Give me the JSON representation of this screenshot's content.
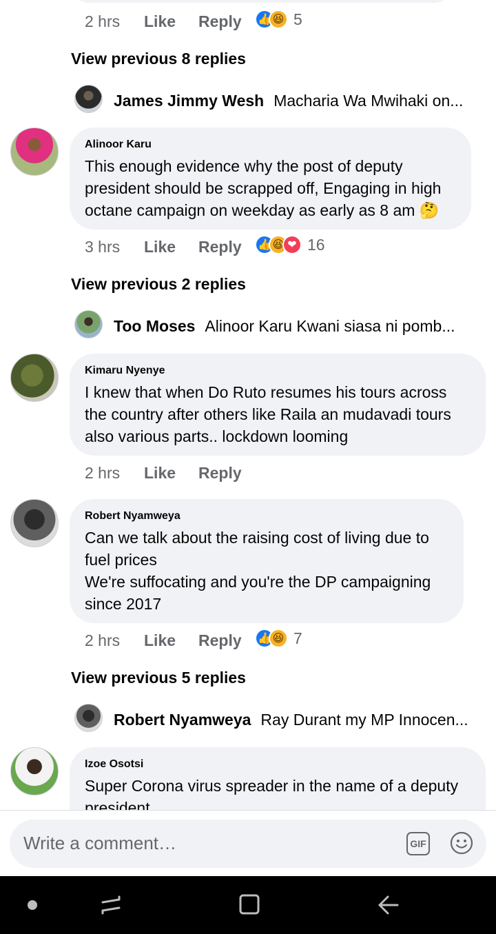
{
  "comments_top": {
    "meta": {
      "time": "2 hrs",
      "like": "Like",
      "reply": "Reply",
      "count": "5"
    },
    "view_prev": "View previous 8 replies",
    "reply": {
      "name": "James Jimmy Wesh",
      "text": "Macharia Wa Mwihaki on..."
    }
  },
  "comment1": {
    "author": "Alinoor Karu",
    "text": "This enough evidence why the post of deputy president should be scrapped off, Engaging in high octane campaign on weekday as early as 8 am 🤔",
    "meta": {
      "time": "3 hrs",
      "like": "Like",
      "reply": "Reply",
      "count": "16"
    },
    "view_prev": "View previous 2 replies",
    "reply": {
      "name": "Too Moses",
      "text": "Alinoor Karu Kwani siasa ni pomb..."
    }
  },
  "comment2": {
    "author": "Kimaru Nyenye",
    "text": "I knew that when Do Ruto resumes his tours across the country after others like Raila an mudavadi tours also various parts.. lockdown looming",
    "meta": {
      "time": "2 hrs",
      "like": "Like",
      "reply": "Reply"
    }
  },
  "comment3": {
    "author": "Robert Nyamweya",
    "line1": "Can we talk about the raising cost of living due to fuel prices",
    "line2": "We're suffocating and you're the DP campaigning since 2017",
    "meta": {
      "time": "2 hrs",
      "like": "Like",
      "reply": "Reply",
      "count": "7"
    },
    "view_prev": "View previous 5 replies",
    "reply": {
      "name": "Robert Nyamweya",
      "text": "Ray Durant my MP Innocen..."
    }
  },
  "comment4": {
    "author": "Izoe Osotsi",
    "text": "Super Corona virus spreader in the name of a deputy president."
  },
  "composer": {
    "placeholder": "Write a comment…",
    "gif": "GIF"
  },
  "icons": [
    "like-icon",
    "haha-icon",
    "love-icon",
    "gif-icon",
    "emoji-icon",
    "home-dot-icon",
    "recents-icon",
    "overview-icon",
    "back-icon"
  ],
  "colors": {
    "accent": "#1877f2",
    "bubble": "#f0f2f5",
    "meta": "#65676b"
  }
}
